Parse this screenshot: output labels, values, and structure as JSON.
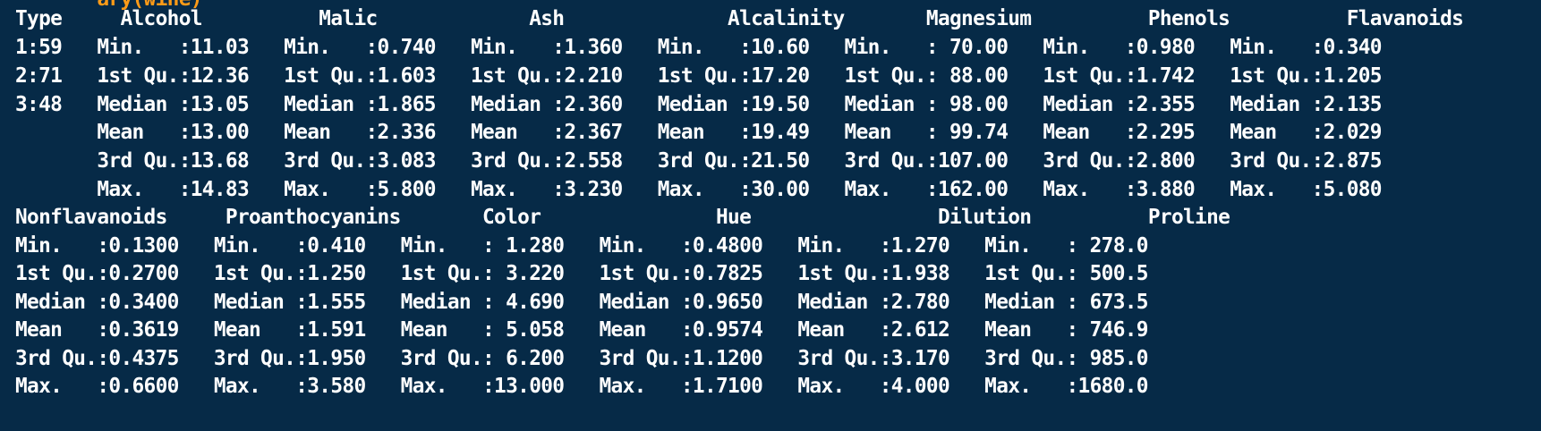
{
  "terminal": {
    "partial_top_line": "       ary(wine)",
    "lines": [
      "Type     Alcohol          Malic             Ash              Alcalinity       Magnesium          Phenols          Flavanoids",
      "1:59   Min.   :11.03   Min.   :0.740   Min.   :1.360   Min.   :10.60   Min.   : 70.00   Min.   :0.980   Min.   :0.340",
      "2:71   1st Qu.:12.36   1st Qu.:1.603   1st Qu.:2.210   1st Qu.:17.20   1st Qu.: 88.00   1st Qu.:1.742   1st Qu.:1.205",
      "3:48   Median :13.05   Median :1.865   Median :2.360   Median :19.50   Median : 98.00   Median :2.355   Median :2.135",
      "       Mean   :13.00   Mean   :2.336   Mean   :2.367   Mean   :19.49   Mean   : 99.74   Mean   :2.295   Mean   :2.029",
      "       3rd Qu.:13.68   3rd Qu.:3.083   3rd Qu.:2.558   3rd Qu.:21.50   3rd Qu.:107.00   3rd Qu.:2.800   3rd Qu.:2.875",
      "       Max.   :14.83   Max.   :5.800   Max.   :3.230   Max.   :30.00   Max.   :162.00   Max.   :3.880   Max.   :5.080",
      "Nonflavanoids     Proanthocyanins       Color               Hue                Dilution          Proline",
      "Min.   :0.1300   Min.   :0.410   Min.   : 1.280   Min.   :0.4800   Min.   :1.270   Min.   : 278.0",
      "1st Qu.:0.2700   1st Qu.:1.250   1st Qu.: 3.220   1st Qu.:0.7825   1st Qu.:1.938   1st Qu.: 500.5",
      "Median :0.3400   Median :1.555   Median : 4.690   Median :0.9650   Median :2.780   Median : 673.5",
      "Mean   :0.3619   Mean   :1.591   Mean   : 5.058   Mean   :0.9574   Mean   :2.612   Mean   : 746.9",
      "3rd Qu.:0.4375   3rd Qu.:1.950   3rd Qu.: 6.200   3rd Qu.:1.1200   3rd Qu.:3.170   3rd Qu.: 985.0",
      "Max.   :0.6600   Max.   :3.580   Max.   :13.000   Max.   :1.7100   Max.   :4.000   Max.   :1680.0"
    ]
  },
  "colors": {
    "background": "#062a47",
    "text": "#ffffff",
    "command": "#ff9b17"
  }
}
